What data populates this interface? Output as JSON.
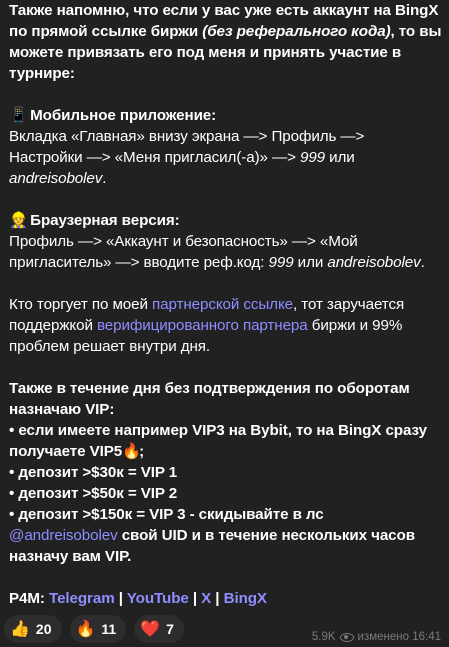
{
  "p1": {
    "l1": "Также напомню, что если у вас уже есть аккаунт на BingX",
    "l2a": "по прямой ссылке биржи ",
    "l2b": "(без реферального кода)",
    "l2c": ", то вы",
    "l3": "можете привязать его под меня и принять участие в",
    "l4": "турнире:"
  },
  "p2": {
    "emoji": "📱",
    "title": "Мобильное приложение:",
    "l1": "Вкладка «Главная» внизу экрана —> Профиль —>",
    "l2a": "Настройки —> «Меня пригласил(-а)» —> ",
    "l2b": "999",
    "l2c": " или",
    "l3": "andreisobolev",
    "l3end": "."
  },
  "p3": {
    "emoji": "👷",
    "title": "Браузерная версия:",
    "l1": "Профиль —>  «Аккаунт и безопасность» —> «Мой",
    "l2a": "пригласитель» —> вводите реф.код: ",
    "l2b": "999",
    "l2c": " или ",
    "l2d": "andreisobolev",
    "l2e": "."
  },
  "p4": {
    "l1a": "Кто торгует по моей ",
    "l1link": "партнерской ссылке",
    "l1b": ", тот заручается",
    "l2a": "поддержкой ",
    "l2link": "верифицированного партнера",
    "l2b": " биржи и 99%",
    "l3": "проблем решает внутри дня."
  },
  "p5": {
    "l1": "Также в течение дня без подтверждения по оборотам",
    "l2": "назначаю VIP:",
    "l3": "• если имеете например VIP3 на Bybit, то на BingX сразу",
    "l4": "получаете VIP5",
    "l4emoji": "🔥",
    "l4end": ";",
    "l5": "• депозит >$30к = VIP 1",
    "l6": "• депозит >$50к = VIP 2",
    "l7": "• депозит >$150к = VIP 3 - скидывайте в лс",
    "l8link": "@andreisobolev",
    "l8b": " свой UID и в течение нескольких часов",
    "l9": "назначу вам VIP."
  },
  "p6": {
    "label": "P4M: ",
    "links": [
      "Telegram",
      "YouTube",
      "X",
      "BingX"
    ],
    "sep": " | "
  },
  "reactions": [
    {
      "icon": "👍",
      "count": "20"
    },
    {
      "icon": "🔥",
      "count": "11"
    },
    {
      "icon": "❤️",
      "count": "7"
    }
  ],
  "meta": {
    "views": "5.9K",
    "edited": "изменено 16:41"
  },
  "colors": {
    "background": "#212121",
    "link": "#8f8dff",
    "meta": "#7b7b7b"
  }
}
